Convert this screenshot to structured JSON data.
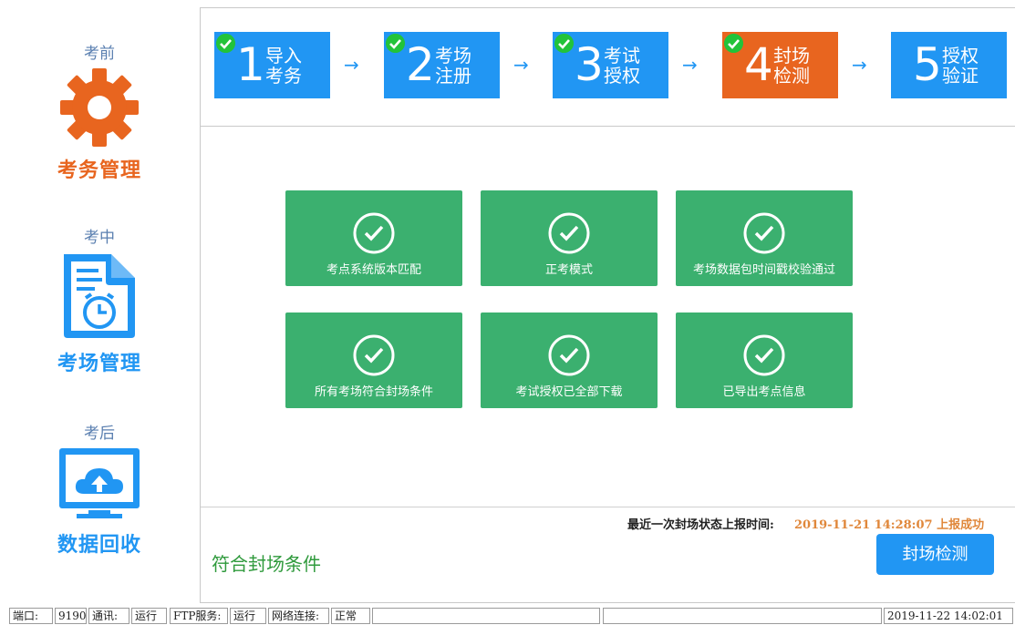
{
  "sidebar": {
    "items": [
      {
        "subtitle": "考前",
        "title": "考务管理",
        "icon": "gear-icon",
        "color": "#e8651f"
      },
      {
        "subtitle": "考中",
        "title": "考场管理",
        "icon": "document-clock-icon",
        "color": "#2196f3"
      },
      {
        "subtitle": "考后",
        "title": "数据回收",
        "icon": "monitor-cloud-upload-icon",
        "color": "#2196f3"
      }
    ]
  },
  "steps": [
    {
      "number": "1",
      "line1": "导入",
      "line2": "考务",
      "done": true
    },
    {
      "number": "2",
      "line1": "考场",
      "line2": "注册",
      "done": true
    },
    {
      "number": "3",
      "line1": "考试",
      "line2": "授权",
      "done": true
    },
    {
      "number": "4",
      "line1": "封场",
      "line2": "检测",
      "done": true,
      "active": true
    },
    {
      "number": "5",
      "line1": "授权",
      "line2": "验证",
      "done": false
    }
  ],
  "arrow_glyph": "→",
  "checks": [
    {
      "label": "考点系统版本匹配"
    },
    {
      "label": "正考模式"
    },
    {
      "label": "考场数据包时间戳校验通过"
    },
    {
      "label": "所有考场符合封场条件"
    },
    {
      "label": "考试授权已全部下载"
    },
    {
      "label": "已导出考点信息"
    }
  ],
  "footer": {
    "report_label": "最近一次封场状态上报时间:",
    "report_time": "2019-11-21 14:28:07 上报成功",
    "condition_text": "符合封场条件",
    "check_button": "封场检测"
  },
  "statusbar": {
    "port_label": "端口:",
    "port_value": "9190",
    "comm_label": "通讯:",
    "comm_value": "运行",
    "ftp_label": "FTP服务:",
    "ftp_value": "运行",
    "net_label": "网络连接:",
    "net_value": "正常",
    "datetime": "2019-11-22 14:02:01"
  },
  "colors": {
    "accent_blue": "#2196f3",
    "accent_orange": "#e8651f",
    "card_green": "#3bb06f",
    "success_text": "#2f9a3c",
    "report_time": "#e0873a"
  }
}
